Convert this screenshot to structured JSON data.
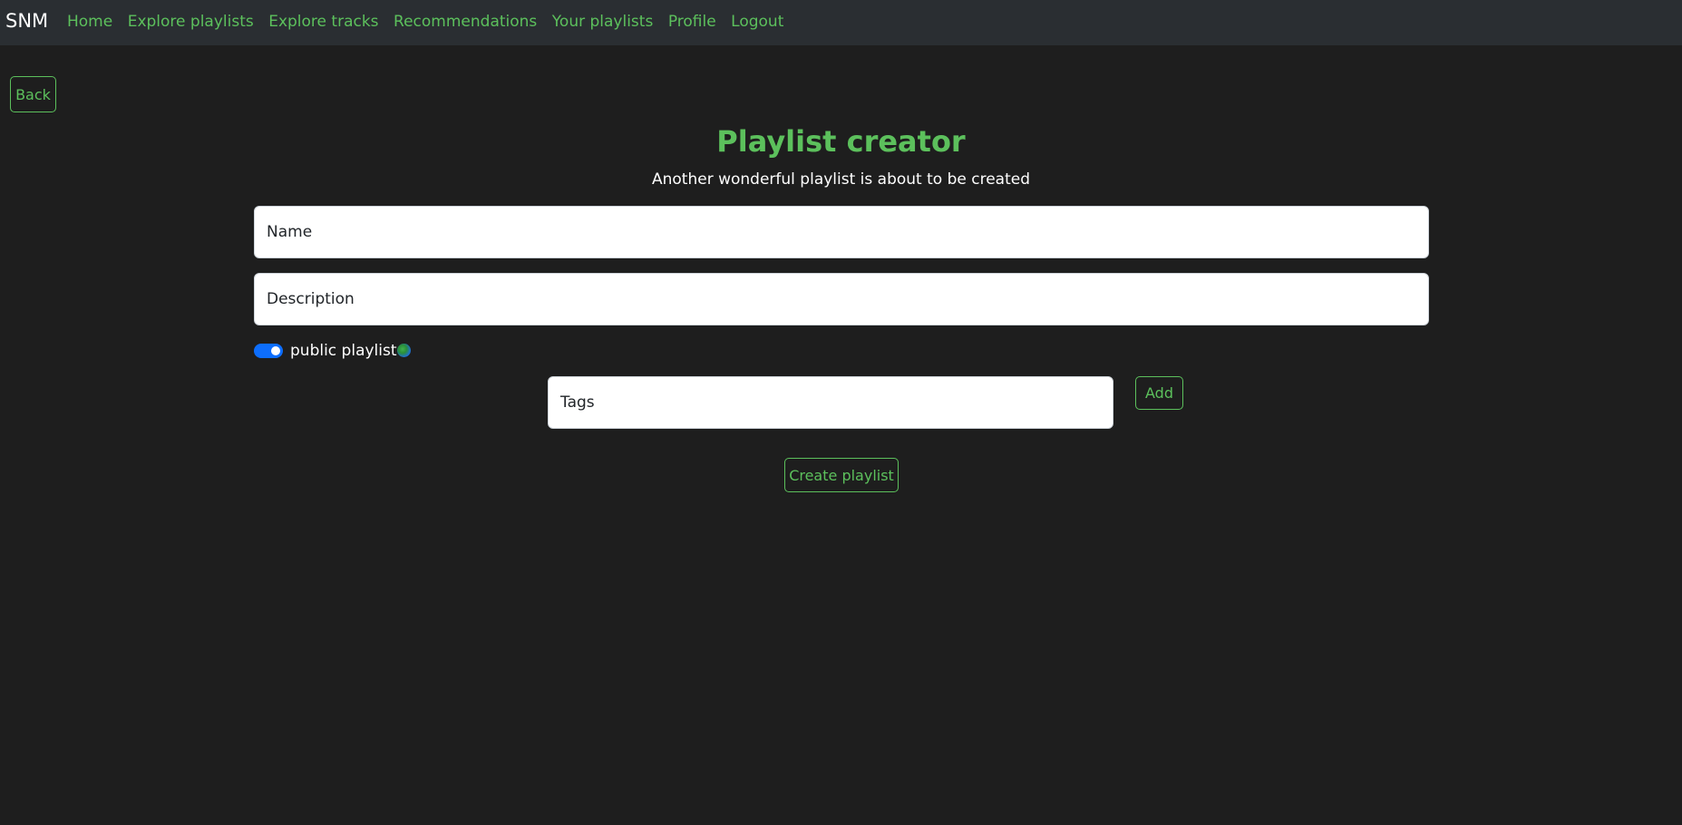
{
  "nav": {
    "brand": "SNM",
    "links": [
      {
        "label": "Home"
      },
      {
        "label": "Explore playlists"
      },
      {
        "label": "Explore tracks"
      },
      {
        "label": "Recommendations"
      },
      {
        "label": "Your playlists"
      },
      {
        "label": "Profile"
      },
      {
        "label": "Logout"
      }
    ]
  },
  "back_button": {
    "label": "Back"
  },
  "header": {
    "title": "Playlist creator",
    "subtitle": "Another wonderful playlist is about to be created"
  },
  "form": {
    "name_placeholder": "Name",
    "description_placeholder": "Description",
    "public_toggle": {
      "label": "public playlist",
      "checked": true,
      "icon": "globe-icon"
    },
    "tags_placeholder": "Tags",
    "add_label": "Add",
    "create_label": "Create playlist"
  },
  "colors": {
    "accent": "#5cc05c",
    "background": "#1e1e1e",
    "navbar": "#2a2e32",
    "toggle": "#0d6efd"
  }
}
